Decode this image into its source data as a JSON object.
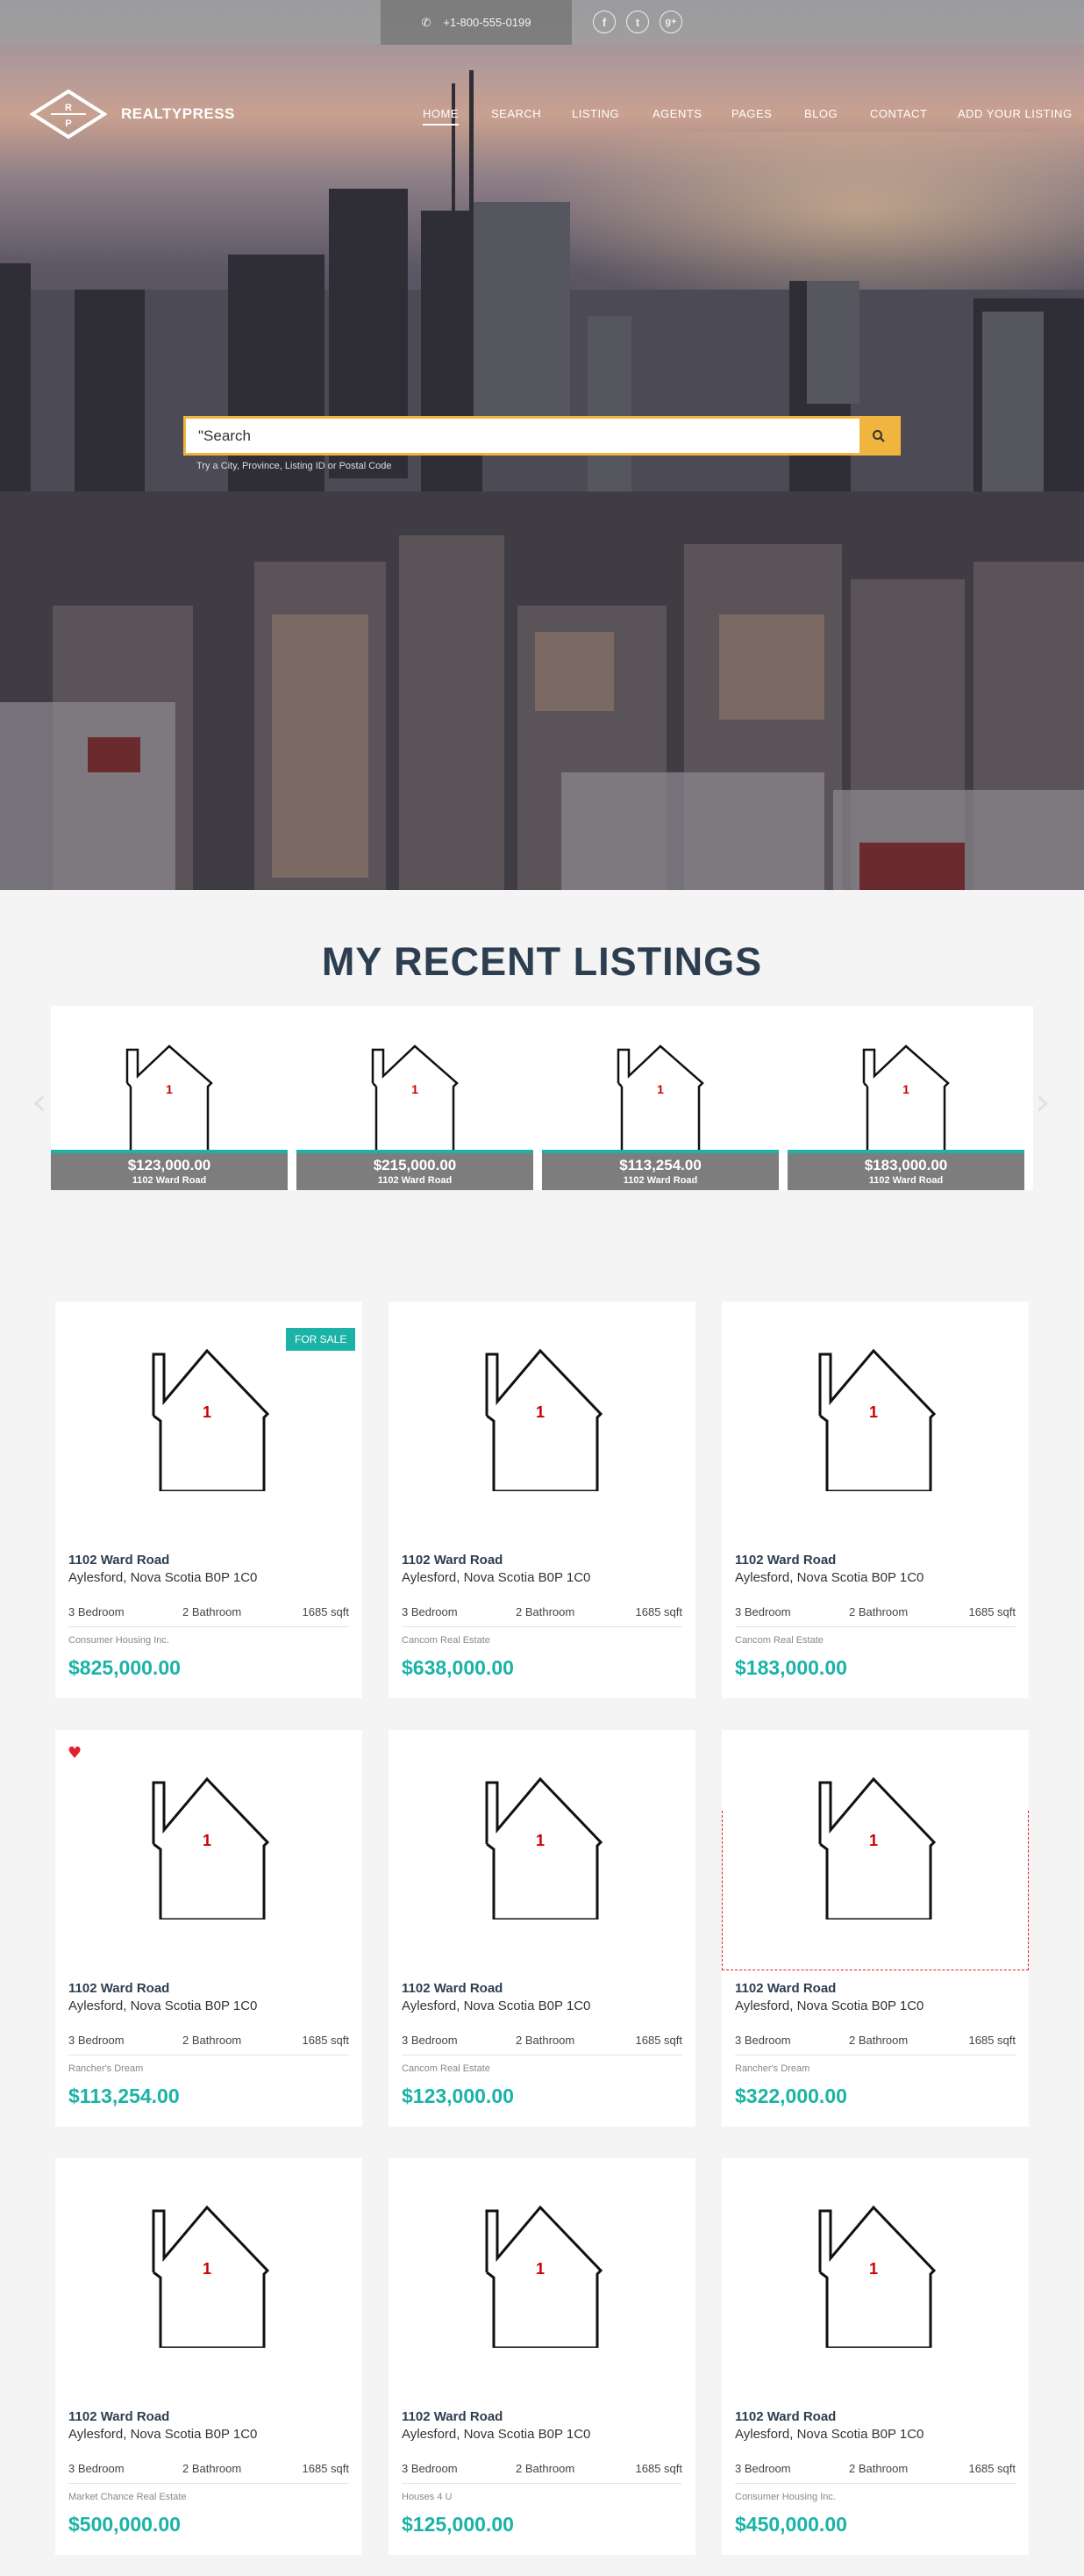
{
  "topbar": {
    "phone": "+1-800-555-0199",
    "social": [
      {
        "icon": "facebook-icon",
        "glyph": "f"
      },
      {
        "icon": "twitter-icon",
        "glyph": "t"
      },
      {
        "icon": "google-plus-icon",
        "glyph": "g+"
      }
    ]
  },
  "brand": {
    "name": "REALTYPRESS",
    "logo_letters": "R P"
  },
  "nav": [
    "HOME",
    "SEARCH",
    "LISTING",
    "AGENTS",
    "PAGES",
    "BLOG",
    "CONTACT",
    "ADD YOUR LISTING"
  ],
  "search": {
    "placeholder": "\"Search",
    "hint": "Try a City, Province, Listing ID or Postal Code"
  },
  "recent": {
    "title": "MY RECENT LISTINGS",
    "items": [
      {
        "price": "$123,000.00",
        "address": "1102 Ward Road",
        "image_label": "1"
      },
      {
        "price": "$215,000.00",
        "address": "1102 Ward Road",
        "image_label": "1"
      },
      {
        "price": "$113,254.00",
        "address": "1102 Ward Road",
        "image_label": "1"
      },
      {
        "price": "$183,000.00",
        "address": "1102 Ward Road",
        "image_label": "1"
      }
    ]
  },
  "listings": [
    {
      "street": "1102 Ward Road",
      "city": "Aylesford, Nova Scotia B0P 1C0",
      "bedrooms": "3 Bedroom",
      "bathrooms": "2 Bathroom",
      "sqft": "1685 sqft",
      "agent": "Consumer Housing Inc.",
      "price": "$825,000.00",
      "badge": "FOR SALE",
      "image_label": "1"
    },
    {
      "street": "1102 Ward Road",
      "city": "Aylesford, Nova Scotia B0P 1C0",
      "bedrooms": "3 Bedroom",
      "bathrooms": "2 Bathroom",
      "sqft": "1685 sqft",
      "agent": "Cancom Real Estate",
      "price": "$638,000.00",
      "image_label": "1"
    },
    {
      "street": "1102 Ward Road",
      "city": "Aylesford, Nova Scotia B0P 1C0",
      "bedrooms": "3 Bedroom",
      "bathrooms": "2 Bathroom",
      "sqft": "1685 sqft",
      "agent": "Cancom Real Estate",
      "price": "$183,000.00",
      "image_label": "1"
    },
    {
      "street": "1102 Ward Road",
      "city": "Aylesford, Nova Scotia B0P 1C0",
      "bedrooms": "3 Bedroom",
      "bathrooms": "2 Bathroom",
      "sqft": "1685 sqft",
      "agent": "Rancher's Dream",
      "price": "$113,254.00",
      "favorite": true,
      "image_label": "1"
    },
    {
      "street": "1102 Ward Road",
      "city": "Aylesford, Nova Scotia B0P 1C0",
      "bedrooms": "3 Bedroom",
      "bathrooms": "2 Bathroom",
      "sqft": "1685 sqft",
      "agent": "Cancom Real Estate",
      "price": "$123,000.00",
      "image_label": "1"
    },
    {
      "street": "1102 Ward Road",
      "city": "Aylesford, Nova Scotia B0P 1C0",
      "bedrooms": "3 Bedroom",
      "bathrooms": "2 Bathroom",
      "sqft": "1685 sqft",
      "agent": "Rancher's Dream",
      "price": "$322,000.00",
      "image_label": "1"
    },
    {
      "street": "1102 Ward Road",
      "city": "Aylesford, Nova Scotia B0P 1C0",
      "bedrooms": "3 Bedroom",
      "bathrooms": "2 Bathroom",
      "sqft": "1685 sqft",
      "agent": "Market Chance Real Estate",
      "price": "$500,000.00",
      "image_label": "1"
    },
    {
      "street": "1102 Ward Road",
      "city": "Aylesford, Nova Scotia B0P 1C0",
      "bedrooms": "3 Bedroom",
      "bathrooms": "2 Bathroom",
      "sqft": "1685 sqft",
      "agent": "Houses 4 U",
      "price": "$125,000.00",
      "image_label": "1"
    },
    {
      "street": "1102 Ward Road",
      "city": "Aylesford, Nova Scotia B0P 1C0",
      "bedrooms": "3 Bedroom",
      "bathrooms": "2 Bathroom",
      "sqft": "1685 sqft",
      "agent": "Consumer Housing Inc.",
      "price": "$450,000.00",
      "image_label": "1"
    }
  ],
  "colors": {
    "accent": "#1bb3a7",
    "search_border": "#f0b53e",
    "title": "#2d3e50",
    "favorite": "#e2202a"
  }
}
